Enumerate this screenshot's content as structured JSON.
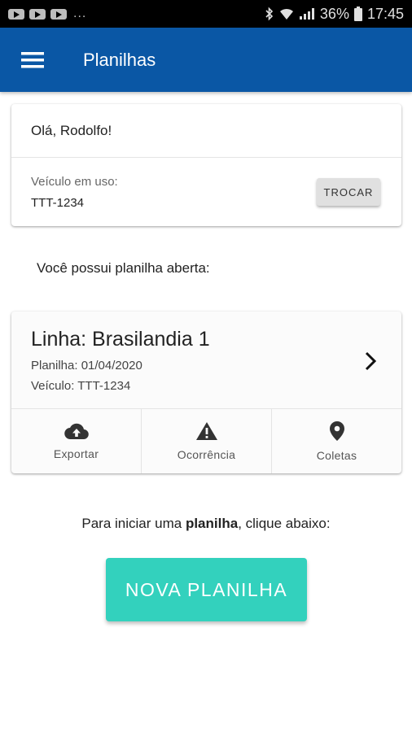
{
  "status_bar": {
    "notification_icons": [
      "video-notification-icon",
      "video-notification-icon",
      "video-notification-icon"
    ],
    "more": "...",
    "battery": "36%",
    "time": "17:45"
  },
  "app_bar": {
    "title": "Planilhas",
    "background": "#0a57a5"
  },
  "greeting_card": {
    "greeting": "Olá, Rodolfo!",
    "vehicle_label": "Veículo em uso:",
    "vehicle_plate": "TTT-1234",
    "swap_label": "TROCAR"
  },
  "open_message": "Você possui planilha aberta:",
  "sheet_card": {
    "line": "Linha: Brasilandia 1",
    "sheet": "Planilha: 01/04/2020",
    "vehicle": "Veículo: TTT-1234",
    "actions": [
      {
        "icon": "cloud-upload-icon",
        "label": "Exportar"
      },
      {
        "icon": "warning-icon",
        "label": "Ocorrência"
      },
      {
        "icon": "location-pin-icon",
        "label": "Coletas"
      }
    ]
  },
  "start_message": {
    "before": "Para iniciar uma ",
    "bold": "planilha",
    "after": ", clique abaixo:"
  },
  "new_sheet_button": {
    "label": "NOVA PLANILHA",
    "color": "#33d1bd"
  }
}
